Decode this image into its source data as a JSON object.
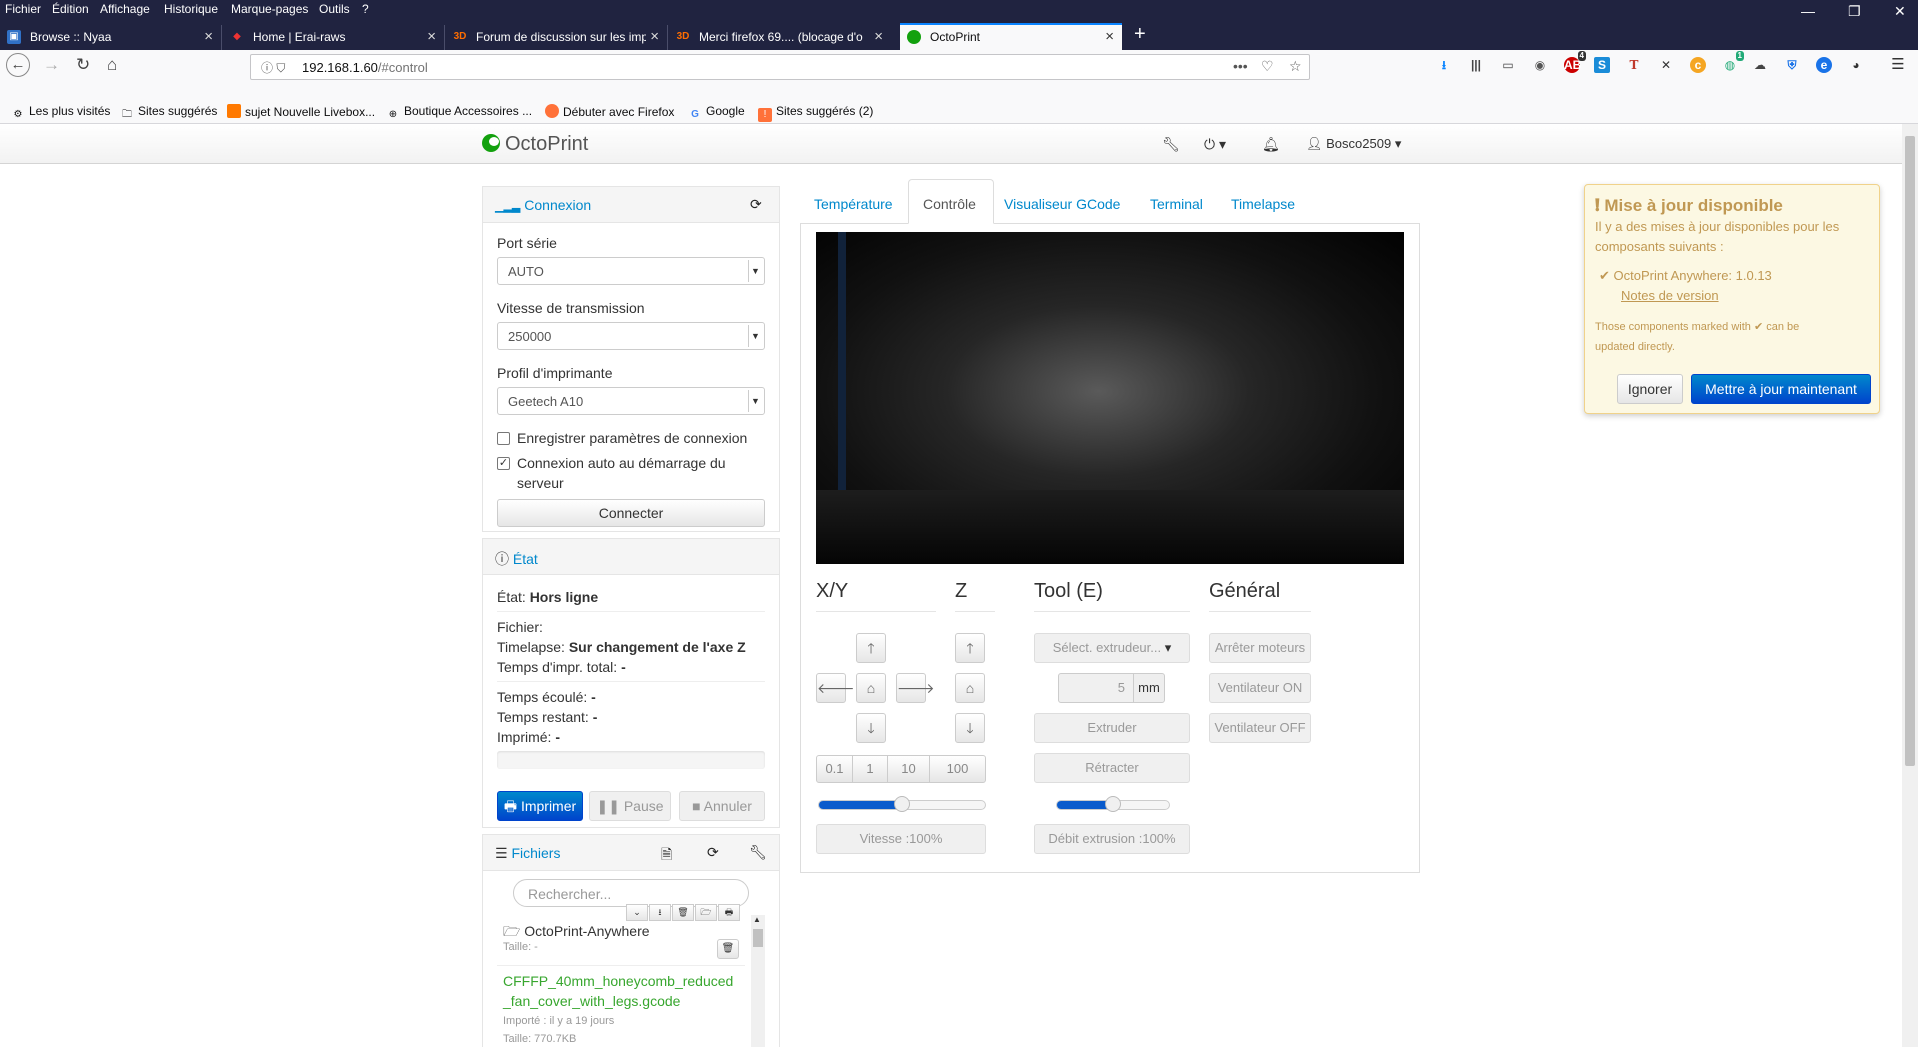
{
  "menubar": {
    "items": [
      "Fichier",
      "Édition",
      "Affichage",
      "Historique",
      "Marque-pages",
      "Outils",
      "?"
    ],
    "window_controls": [
      "—",
      "❐",
      "✕"
    ]
  },
  "browser_tabs": [
    {
      "title": "Browse :: Nyaa",
      "icon": "nyaa-favicon"
    },
    {
      "title": "Home | Erai-raws",
      "icon": "erai-favicon"
    },
    {
      "title": "Forum de discussion sur les imp",
      "icon": "3d-favicon"
    },
    {
      "title": "Merci firefox 69.... (blocage d'o",
      "icon": "3d-favicon"
    },
    {
      "title": "OctoPrint",
      "icon": "octoprint-favicon",
      "active": true
    }
  ],
  "newtab": "+",
  "url": {
    "host": "192.168.1.60",
    "path": "/#control",
    "more": "•••"
  },
  "bookmarks": [
    {
      "label": "Les plus visités"
    },
    {
      "label": "Sites suggérés"
    },
    {
      "label": "sujet Nouvelle Livebox..."
    },
    {
      "label": "Boutique Accessoires ..."
    },
    {
      "label": "Débuter avec Firefox"
    },
    {
      "label": "Google"
    },
    {
      "label": "Sites suggérés (2)"
    }
  ],
  "toolbar_badges": {
    "adblock": "4",
    "ext": "1"
  },
  "octoprint": {
    "brand": "OctoPrint",
    "user": "Bosco2509",
    "connection": {
      "title": "Connexion",
      "port_label": "Port série",
      "port_value": "AUTO",
      "baud_label": "Vitesse de transmission",
      "baud_value": "250000",
      "profile_label": "Profil d'imprimante",
      "profile_value": "Geetech A10",
      "save_label": "Enregistrer paramètres de connexion",
      "save_checked": false,
      "autoconnect_label_1": "Connexion auto au démarrage du",
      "autoconnect_label_2": "serveur",
      "autoconnect_checked": true,
      "connect_button": "Connecter"
    },
    "state": {
      "title": "État",
      "state_label": "État:",
      "state_value": "Hors ligne",
      "file_label": "Fichier:",
      "timelapse_label": "Timelapse:",
      "timelapse_value": "Sur changement de l'axe Z",
      "total_label": "Temps d'impr. total:",
      "total_value": "-",
      "elapsed_label": "Temps écoulé:",
      "elapsed_value": "-",
      "remaining_label": "Temps restant:",
      "remaining_value": "-",
      "printed_label": "Imprimé:",
      "printed_value": "-",
      "print_button": "Imprimer",
      "pause_button": "Pause",
      "cancel_button": "Annuler"
    },
    "files": {
      "title": "Fichiers",
      "search_placeholder": "Rechercher...",
      "items": [
        {
          "name": "OctoPrint-Anywhere",
          "size": "Taille: -"
        },
        {
          "name_1": "CFFFP_40mm_honeycomb_reduced",
          "name_2": "_fan_cover_with_legs.gcode",
          "imported": "Importé : il y a 19 jours",
          "size": "Taille: 770.7KB"
        }
      ]
    },
    "tabs": [
      "Température",
      "Contrôle",
      "Visualiseur GCode",
      "Terminal",
      "Timelapse"
    ],
    "active_tab": "Contrôle",
    "control": {
      "xy_title": "X/Y",
      "z_title": "Z",
      "tool_title": "Tool (E)",
      "general_title": "Général",
      "steps": [
        "0.1",
        "1",
        "10",
        "100"
      ],
      "speed_label": "Vitesse :100%",
      "speed_slider_fraction": 0.5,
      "extruder_select": "Sélect. extrudeur...",
      "extrude_amount": "5",
      "extrude_unit": "mm",
      "extrude_button": "Extruder",
      "retract_button": "Rétracter",
      "flow_label": "Débit extrusion :100%",
      "flow_slider_fraction": 0.5,
      "motors_off": "Arrêter moteurs",
      "fan_on": "Ventilateur ON",
      "fan_off": "Ventilateur OFF"
    },
    "update_notice": {
      "title": "Mise à jour disponible",
      "text_1": "Il y a des mises à jour disponibles pour les",
      "text_2": "composants suivants :",
      "component": "OctoPrint Anywhere: 1.0.13",
      "notes_link": "Notes de version",
      "footnote_1": "Those components marked with",
      "footnote_2": "can be",
      "footnote_3": "updated directly.",
      "ignore_button": "Ignorer",
      "update_button": "Mettre à jour maintenant"
    }
  }
}
